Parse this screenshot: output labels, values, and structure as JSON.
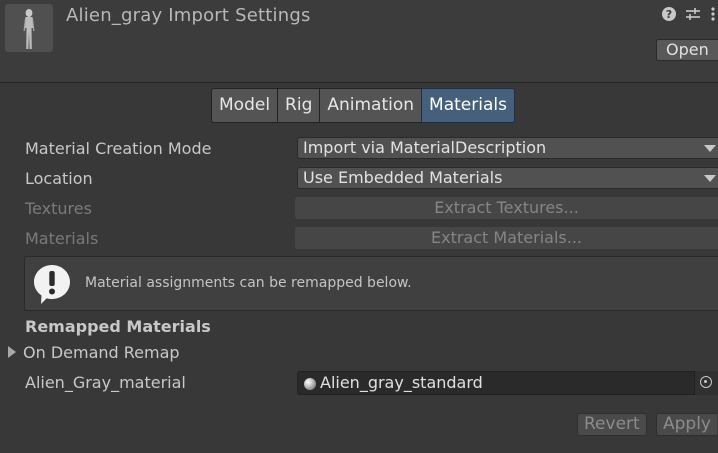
{
  "header": {
    "title": "Alien_gray Import Settings",
    "help_icon": "help-circle-icon",
    "settings_icon": "sliders-icon",
    "more_icon": "vertical-ellipsis-icon",
    "open_label": "Open"
  },
  "tabs": [
    {
      "label": "Model",
      "active": false
    },
    {
      "label": "Rig",
      "active": false
    },
    {
      "label": "Animation",
      "active": false
    },
    {
      "label": "Materials",
      "active": true
    }
  ],
  "fields": {
    "material_creation_mode": {
      "label": "Material Creation Mode",
      "value": "Import via MaterialDescription"
    },
    "location": {
      "label": "Location",
      "value": "Use Embedded Materials"
    },
    "textures": {
      "label": "Textures",
      "button": "Extract Textures..."
    },
    "materials": {
      "label": "Materials",
      "button": "Extract Materials..."
    }
  },
  "help": {
    "icon": "info-exclamation-icon",
    "text": "Material assignments can be remapped below."
  },
  "remapped": {
    "title": "Remapped Materials",
    "foldout_label": "On Demand Remap",
    "material_label": "Alien_Gray_material",
    "material_value": "Alien_gray_standard"
  },
  "actions": {
    "revert_label": "Revert",
    "apply_label": "Apply"
  },
  "colors": {
    "active_tab": "#46607c",
    "background": "#383838"
  }
}
